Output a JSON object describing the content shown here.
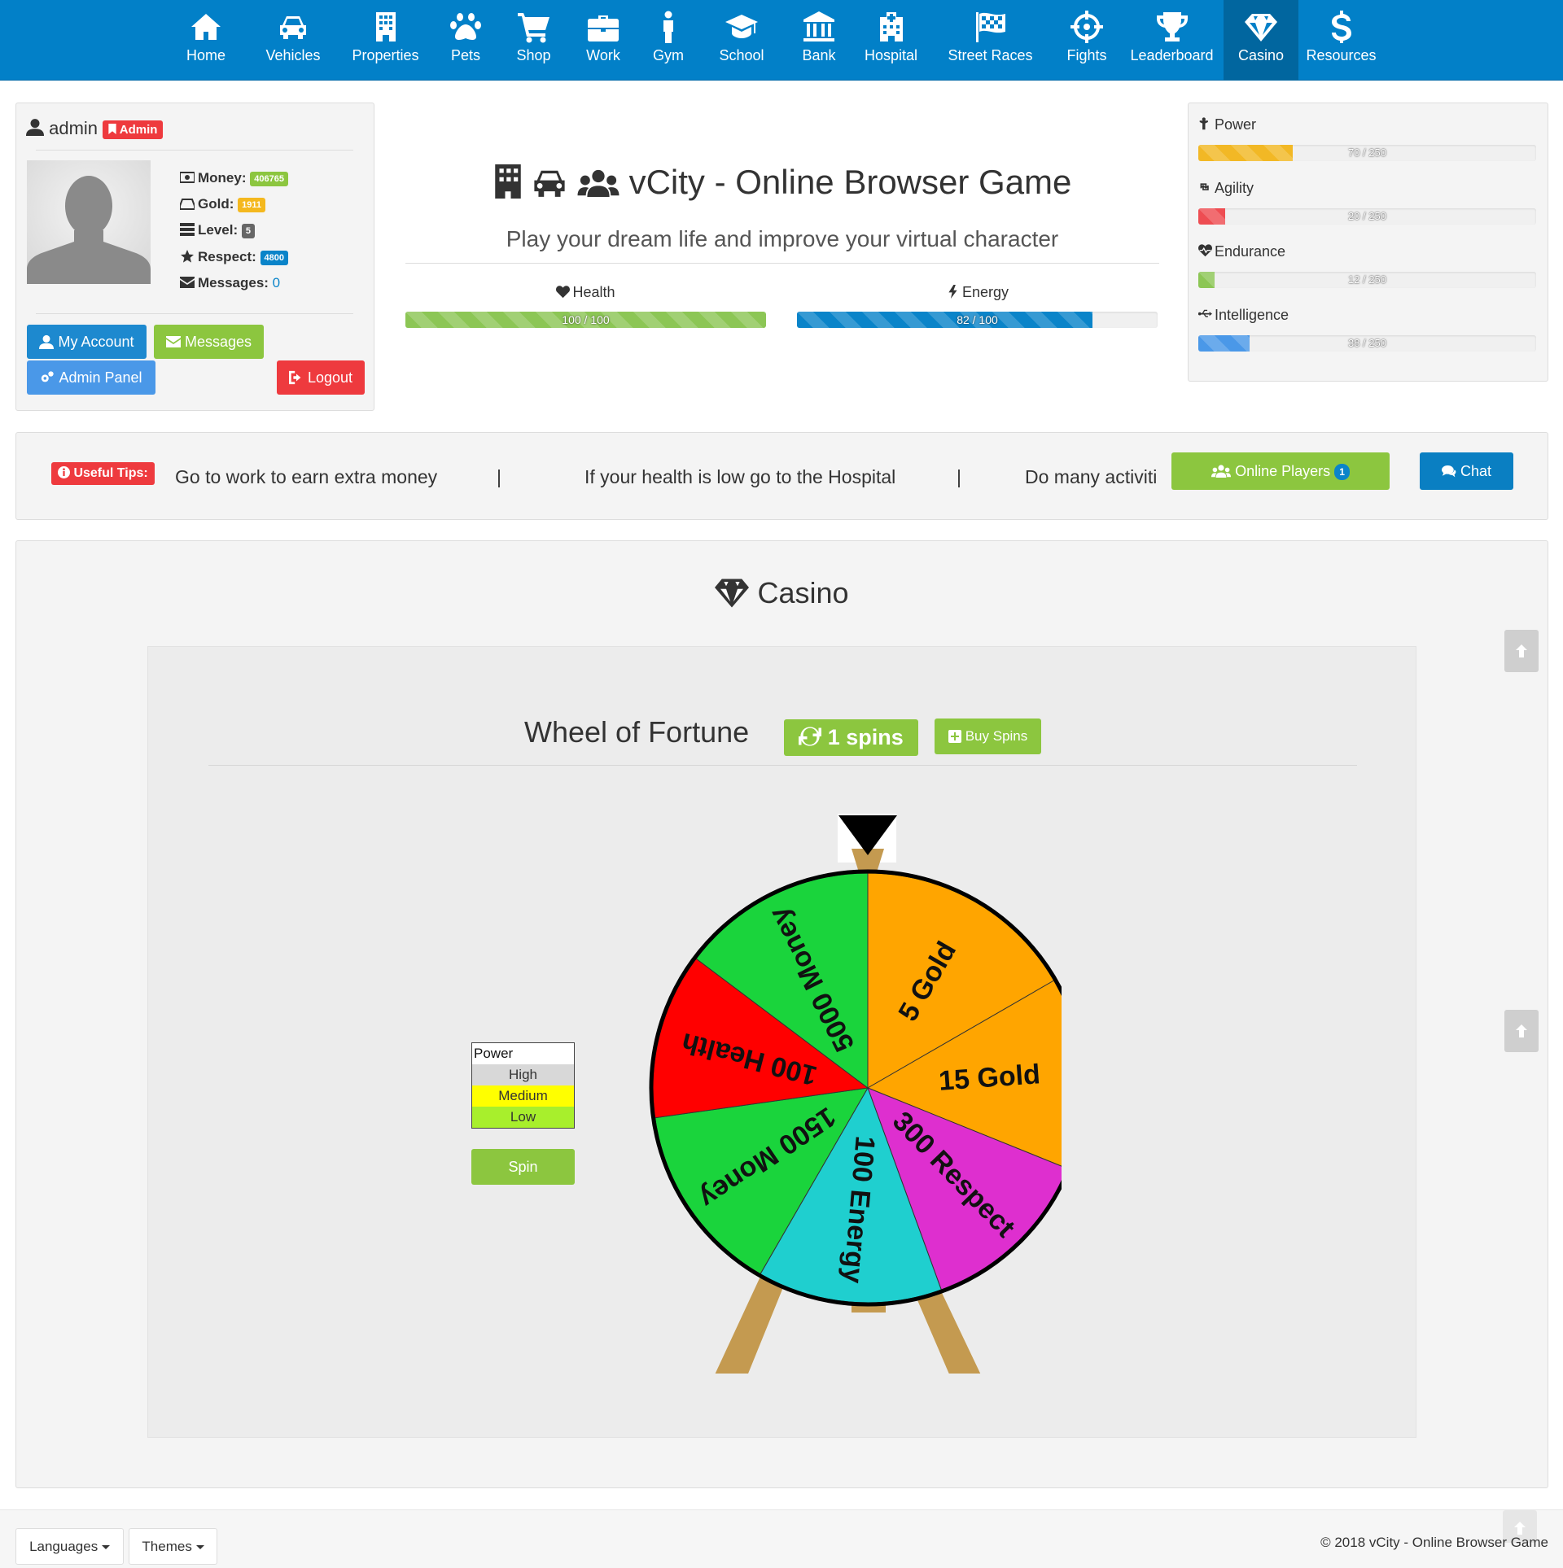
{
  "nav": {
    "items": [
      {
        "label": "Home",
        "icon": "home-icon"
      },
      {
        "label": "Vehicles",
        "icon": "car-icon"
      },
      {
        "label": "Properties",
        "icon": "building-icon"
      },
      {
        "label": "Pets",
        "icon": "paw-icon"
      },
      {
        "label": "Shop",
        "icon": "cart-icon"
      },
      {
        "label": "Work",
        "icon": "briefcase-icon"
      },
      {
        "label": "Gym",
        "icon": "person-icon"
      },
      {
        "label": "School",
        "icon": "graduation-cap-icon"
      },
      {
        "label": "Bank",
        "icon": "bank-icon"
      },
      {
        "label": "Hospital",
        "icon": "hospital-icon"
      },
      {
        "label": "Street Races",
        "icon": "flag-checkered-icon"
      },
      {
        "label": "Fights",
        "icon": "crosshairs-icon"
      },
      {
        "label": "Leaderboard",
        "icon": "trophy-icon"
      },
      {
        "label": "Casino",
        "icon": "diamond-icon"
      },
      {
        "label": "Resources",
        "icon": "dollar-icon"
      }
    ],
    "active": "Casino"
  },
  "profile": {
    "username": "admin",
    "role_badge": "Admin",
    "money_label": "Money:",
    "money": "406765",
    "gold_label": "Gold:",
    "gold": "1911",
    "level_label": "Level:",
    "level": "5",
    "respect_label": "Respect:",
    "respect": "4800",
    "messages_label": "Messages:",
    "messages": "0",
    "my_account": "My Account",
    "messages_btn": "Messages",
    "admin_panel": "Admin Panel",
    "logout": "Logout"
  },
  "hero": {
    "title": "vCity - Online Browser Game",
    "subtitle": "Play your dream life and improve your virtual character",
    "health_label": "Health",
    "health_text": "100 / 100",
    "health_pct": 100,
    "energy_label": "Energy",
    "energy_text": "82 / 100",
    "energy_pct": 82
  },
  "stats": [
    {
      "label": "Power",
      "text": "70 / 250",
      "value": 70,
      "max": 250,
      "color": "#f2b825",
      "icon": "power-icon"
    },
    {
      "label": "Agility",
      "text": "20 / 250",
      "value": 20,
      "max": 250,
      "color": "#ee4d52",
      "icon": "retweet-icon"
    },
    {
      "label": "Endurance",
      "text": "12 / 250",
      "value": 12,
      "max": 250,
      "color": "#8cc655",
      "icon": "heartbeat-icon"
    },
    {
      "label": "Intelligence",
      "text": "38 / 250",
      "value": 38,
      "max": 250,
      "color": "#4a98e8",
      "icon": "usb-icon"
    }
  ],
  "tips": {
    "badge": "Useful Tips:",
    "items": [
      "Go to work to earn extra money",
      "|",
      "If your health is low go to the Hospital",
      "|",
      "Do many activiti"
    ],
    "online_players": "Online Players",
    "online_count": "1",
    "chat": "Chat"
  },
  "casino": {
    "title": "Casino",
    "wheel_title": "Wheel of Fortune",
    "spins": "1 spins",
    "buy_spins": "Buy Spins",
    "power_title": "Power",
    "power_levels": [
      "High",
      "Medium",
      "Low"
    ],
    "spin_button": "Spin",
    "segments": [
      {
        "label": "5 Gold",
        "color": "#ffa500"
      },
      {
        "label": "15 Gold",
        "color": "#ffa500"
      },
      {
        "label": "300 Respect",
        "color": "#de2fcf"
      },
      {
        "label": "100 Energy",
        "color": "#1fcfcf"
      },
      {
        "label": "1500 Money",
        "color": "#1ad43c"
      },
      {
        "label": "100 Health",
        "color": "#ff0000"
      },
      {
        "label": "5000 Money",
        "color": "#1ad43c"
      }
    ]
  },
  "footer": {
    "languages": "Languages",
    "themes": "Themes",
    "copyright": "© 2018 vCity - Online Browser Game"
  }
}
